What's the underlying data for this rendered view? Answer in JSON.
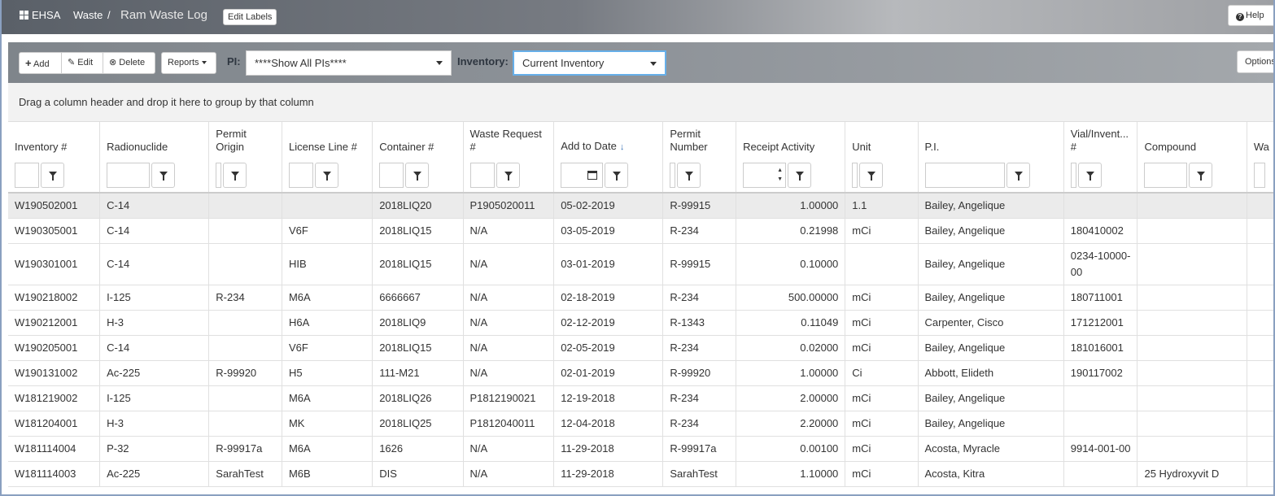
{
  "header": {
    "brand": "EHSA",
    "breadcrumb_section": "Waste",
    "breadcrumb_sep": "/",
    "page_title": "Ram Waste Log",
    "edit_labels": "Edit Labels",
    "help": "Help"
  },
  "toolbar": {
    "add": "Add",
    "edit": "Edit",
    "delete": "Delete",
    "reports": "Reports",
    "pi_label": "PI:",
    "pi_value": "****Show All PIs****",
    "inventory_label": "Inventory:",
    "inventory_value": "Current Inventory",
    "options": "Options"
  },
  "grid": {
    "group_hint": "Drag a column header and drop it here to group by that column",
    "columns": [
      "Inventory #",
      "Radionuclide",
      "Permit Origin",
      "License Line #",
      "Container #",
      "Waste Request #",
      "Add to Date",
      "Permit Number",
      "Receipt Activity",
      "Unit",
      "P.I.",
      "Vial/Invent... #",
      "Compound",
      "Wa"
    ],
    "rows": [
      [
        "W190502001",
        "C-14",
        "",
        "",
        "2018LIQ20",
        "P1905020011",
        "05-02-2019",
        "R-99915",
        "1.00000",
        "1.1",
        "Bailey, Angelique",
        "",
        ""
      ],
      [
        "W190305001",
        "C-14",
        "",
        "V6F",
        "2018LIQ15",
        "N/A",
        "03-05-2019",
        "R-234",
        "0.21998",
        "mCi",
        "Bailey, Angelique",
        "180410002",
        ""
      ],
      [
        "W190301001",
        "C-14",
        "",
        "HIB",
        "2018LIQ15",
        "N/A",
        "03-01-2019",
        "R-99915",
        "0.10000",
        "",
        "Bailey, Angelique",
        "0234-10000-00",
        ""
      ],
      [
        "W190218002",
        "I-125",
        "R-234",
        "M6A",
        "6666667",
        "N/A",
        "02-18-2019",
        "R-234",
        "500.00000",
        "mCi",
        "Bailey, Angelique",
        "180711001",
        ""
      ],
      [
        "W190212001",
        "H-3",
        "",
        "H6A",
        "2018LIQ9",
        "N/A",
        "02-12-2019",
        "R-1343",
        "0.11049",
        "mCi",
        "Carpenter, Cisco",
        "171212001",
        ""
      ],
      [
        "W190205001",
        "C-14",
        "",
        "V6F",
        "2018LIQ15",
        "N/A",
        "02-05-2019",
        "R-234",
        "0.02000",
        "mCi",
        "Bailey, Angelique",
        "181016001",
        ""
      ],
      [
        "W190131002",
        "Ac-225",
        "R-99920",
        "H5",
        "111-M21",
        "N/A",
        "02-01-2019",
        "R-99920",
        "1.00000",
        "Ci",
        "Abbott, Elideth",
        "190117002",
        ""
      ],
      [
        "W181219002",
        "I-125",
        "",
        "M6A",
        "2018LIQ26",
        "P1812190021",
        "12-19-2018",
        "R-234",
        "2.00000",
        "mCi",
        "Bailey, Angelique",
        "",
        ""
      ],
      [
        "W181204001",
        "H-3",
        "",
        "MK",
        "2018LIQ25",
        "P1812040011",
        "12-04-2018",
        "R-234",
        "2.20000",
        "mCi",
        "Bailey, Angelique",
        "",
        ""
      ],
      [
        "W181114004",
        "P-32",
        "R-99917a",
        "M6A",
        "1626",
        "N/A",
        "11-29-2018",
        "R-99917a",
        "0.00100",
        "mCi",
        "Acosta, Myracle",
        "9914-001-00",
        ""
      ],
      [
        "W181114003",
        "Ac-225",
        "SarahTest",
        "M6B",
        "DIS",
        "N/A",
        "11-29-2018",
        "SarahTest",
        "1.10000",
        "mCi",
        "Acosta, Kitra",
        "",
        "25 Hydroxyvit D"
      ]
    ]
  }
}
